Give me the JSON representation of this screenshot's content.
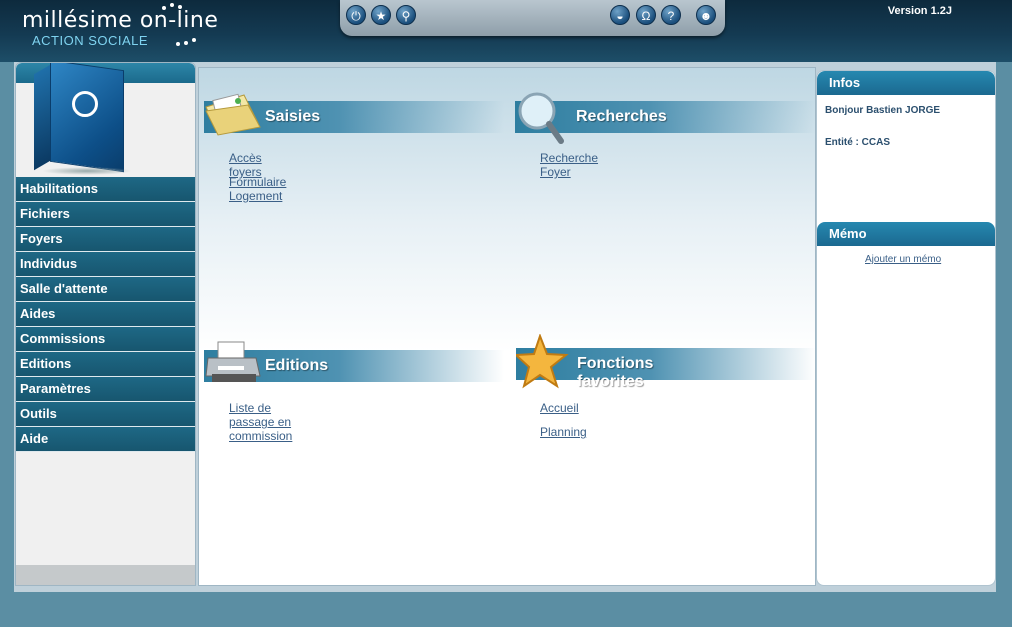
{
  "header": {
    "brand": "millésime on-line",
    "subtitle": "ACTION SOCIALE",
    "version": "Version 1.2J",
    "toolbar_icons": [
      "power-icon",
      "star-icon",
      "network-icon",
      "graduation-icon",
      "headset-icon",
      "help-icon",
      "user-icon"
    ]
  },
  "sidebar": {
    "items": [
      {
        "label": "Habilitations"
      },
      {
        "label": "Fichiers"
      },
      {
        "label": "Foyers"
      },
      {
        "label": "Individus"
      },
      {
        "label": "Salle d'attente"
      },
      {
        "label": "Aides"
      },
      {
        "label": "Commissions"
      },
      {
        "label": "Editions"
      },
      {
        "label": "Paramètres"
      },
      {
        "label": "Outils"
      },
      {
        "label": "Aide"
      }
    ]
  },
  "main": {
    "saisies": {
      "title": "Saisies",
      "links": [
        "Accès foyers",
        "Formulaire Logement"
      ]
    },
    "recherches": {
      "title": "Recherches",
      "links": [
        "Recherche Foyer"
      ]
    },
    "editions": {
      "title": "Editions",
      "links": [
        "Liste de passage en commission"
      ]
    },
    "favorites": {
      "title": "Fonctions favorites",
      "links": [
        "Accueil",
        "Planning"
      ]
    }
  },
  "infos": {
    "title": "Infos",
    "greeting": "Bonjour Bastien JORGE",
    "entity": "Entité : CCAS"
  },
  "memo": {
    "title": "Mémo",
    "add_link": "Ajouter un mémo"
  },
  "colors": {
    "accent": "#1e6885",
    "link": "#3a5f87",
    "header": "#143a52"
  }
}
